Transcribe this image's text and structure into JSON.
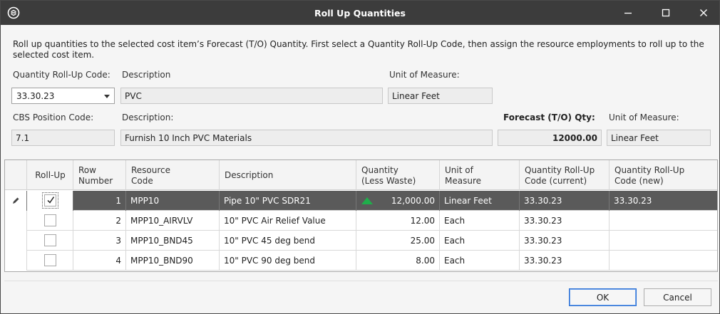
{
  "window": {
    "title": "Roll Up Quantities",
    "minimize_label": "—",
    "maximize_label": "☐",
    "close_label": "✕"
  },
  "intro": "Roll up quantities to the selected cost item’s Forecast (T/O) Quantity. First select a Quantity Roll-Up Code, then assign the resource employments to roll up to the selected cost item.",
  "rollup": {
    "code_label": "Quantity Roll-Up Code:",
    "code_value": "33.30.23",
    "desc_label": "Description",
    "desc_value": "PVC",
    "uom_label": "Unit of Measure:",
    "uom_value": "Linear Feet"
  },
  "cbs": {
    "code_label": "CBS Position Code:",
    "code_value": "7.1",
    "desc_label": "Description:",
    "desc_value": "Furnish 10 Inch PVC Materials",
    "forecast_label": "Forecast (T/O) Qty:",
    "forecast_value": "12000.00",
    "uom_label": "Unit of Measure:",
    "uom_value": "Linear Feet"
  },
  "grid": {
    "headers": {
      "rollup": "Roll-Up",
      "row_number": "Row\nNumber",
      "resource_code": "Resource\nCode",
      "description": "Description",
      "quantity": "Quantity\n(Less Waste)",
      "uom": "Unit of\nMeasure",
      "qrc_current": "Quantity Roll-Up\nCode (current)",
      "qrc_new": "Quantity Roll-Up\nCode (new)"
    },
    "rows": [
      {
        "checked": true,
        "row_number": "1",
        "resource_code": "MPP10",
        "description": "Pipe 10\" PVC SDR21",
        "quantity": "12,000.00",
        "uom": "Linear Feet",
        "qrc_current": "33.30.23",
        "qrc_new": "33.30.23"
      },
      {
        "checked": false,
        "row_number": "2",
        "resource_code": "MPP10_AIRVLV",
        "description": "10\" PVC Air Relief Value",
        "quantity": "12.00",
        "uom": "Each",
        "qrc_current": "33.30.23",
        "qrc_new": ""
      },
      {
        "checked": false,
        "row_number": "3",
        "resource_code": "MPP10_BND45",
        "description": "10\" PVC 45 deg bend",
        "quantity": "25.00",
        "uom": "Each",
        "qrc_current": "33.30.23",
        "qrc_new": ""
      },
      {
        "checked": false,
        "row_number": "4",
        "resource_code": "MPP10_BND90",
        "description": "10\" PVC 90 deg bend",
        "quantity": "8.00",
        "uom": "Each",
        "qrc_current": "33.30.23",
        "qrc_new": ""
      }
    ]
  },
  "buttons": {
    "ok": "OK",
    "cancel": "Cancel"
  }
}
